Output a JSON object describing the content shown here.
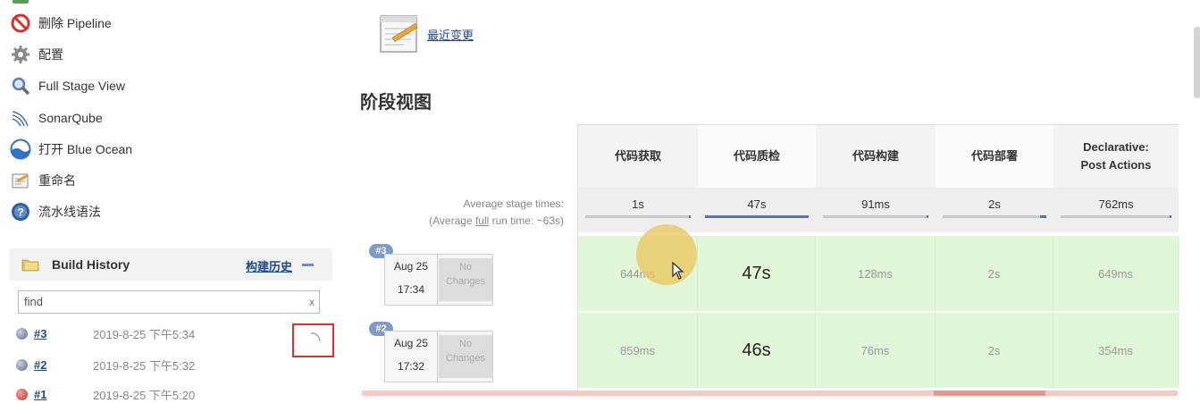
{
  "sidebar": {
    "items": [
      {
        "label": "删除 Pipeline",
        "icon": "no-entry-icon"
      },
      {
        "label": "配置",
        "icon": "gear-icon"
      },
      {
        "label": "Full Stage View",
        "icon": "magnifier-icon"
      },
      {
        "label": "SonarQube",
        "icon": "sonarqube-icon"
      },
      {
        "label": "打开 Blue Ocean",
        "icon": "blue-ocean-icon"
      },
      {
        "label": "重命名",
        "icon": "notepad-icon"
      },
      {
        "label": "流水线语法",
        "icon": "help-icon"
      }
    ]
  },
  "build_history": {
    "title": "Build History",
    "trend_link": "构建历史",
    "search_value": "find",
    "clear_label": "x",
    "builds": [
      {
        "number": "#3",
        "date": "2019-8-25 下午5:34",
        "status_color": "#7a8aa6"
      },
      {
        "number": "#2",
        "date": "2019-8-25 下午5:32",
        "status_color": "#7a8aa6"
      },
      {
        "number": "#1",
        "date": "2019-8-25 下午5:20",
        "status_color": "#d9534f"
      }
    ]
  },
  "main": {
    "recent_changes": "最近变更",
    "stage_view_title": "阶段视图",
    "avg_stage_label": "Average stage times:",
    "avg_full_label_pre": "(Average ",
    "avg_full_label_link": "full",
    "avg_full_label_post": " run time: ~63s)",
    "stages": [
      {
        "name_line1": "代码获取",
        "name_line2": "",
        "avg": "1s",
        "avg_fraction": 0.02
      },
      {
        "name_line1": "代码质检",
        "name_line2": "",
        "avg": "47s",
        "avg_fraction": 1.0
      },
      {
        "name_line1": "代码构建",
        "name_line2": "",
        "avg": "91ms",
        "avg_fraction": 0.02
      },
      {
        "name_line1": "代码部署",
        "name_line2": "",
        "avg": "2s",
        "avg_fraction": 0.06
      },
      {
        "name_line1": "Declarative:",
        "name_line2": "Post Actions",
        "avg": "762ms",
        "avg_fraction": 0.02
      }
    ],
    "runs": [
      {
        "badge": "#3",
        "date": "Aug 25",
        "time": "17:34",
        "changes_line1": "No",
        "changes_line2": "Changes",
        "cells": [
          "644ms",
          "47s",
          "128ms",
          "2s",
          "649ms"
        ]
      },
      {
        "badge": "#2",
        "date": "Aug 25",
        "time": "17:32",
        "changes_line1": "No",
        "changes_line2": "Changes",
        "cells": [
          "859ms",
          "46s",
          "76ms",
          "2s",
          "354ms"
        ]
      }
    ]
  },
  "colors": {
    "success_cell": "#e1f7d8",
    "link": "#204a87",
    "progress": "#4e73c9",
    "highlight_box": "#d9322e"
  }
}
